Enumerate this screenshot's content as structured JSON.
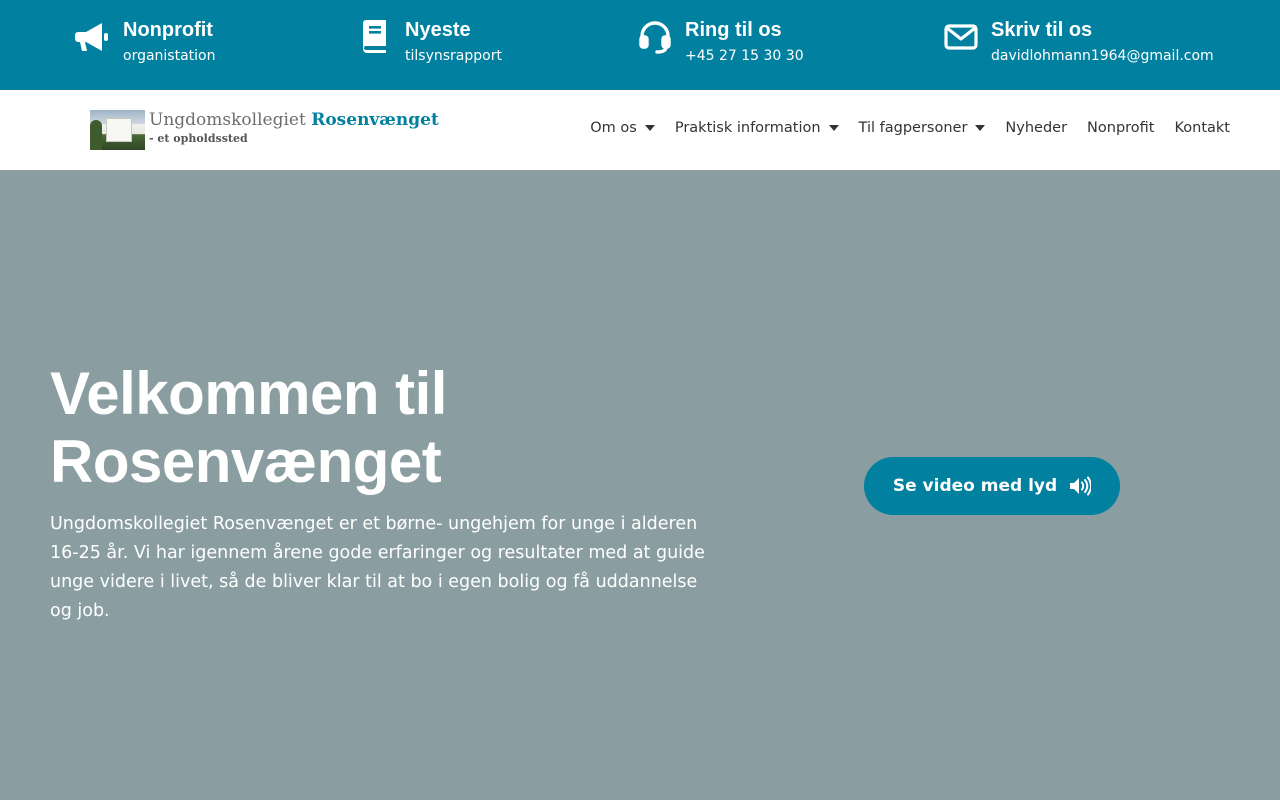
{
  "topbar": {
    "items": [
      {
        "icon": "megaphone-icon",
        "title": "Nonprofit",
        "subtitle": "organistation"
      },
      {
        "icon": "book-icon",
        "title": "Nyeste",
        "subtitle": "tilsynsrapport"
      },
      {
        "icon": "headset-icon",
        "title": "Ring til os",
        "subtitle": "+45 27 15 30 30"
      },
      {
        "icon": "envelope-icon",
        "title": "Skriv til os",
        "subtitle": "davidlohmann1964@gmail.com"
      }
    ],
    "background": "#01809f"
  },
  "header": {
    "logo": {
      "name_part1": "Ungdomskollegiet",
      "name_part2": "Rosenvænget",
      "tagline": "- et opholdssted"
    },
    "nav": [
      {
        "label": "Om os",
        "has_dropdown": true
      },
      {
        "label": "Praktisk information",
        "has_dropdown": true
      },
      {
        "label": "Til fagpersoner",
        "has_dropdown": true
      },
      {
        "label": "Nyheder",
        "has_dropdown": false
      },
      {
        "label": "Nonprofit",
        "has_dropdown": false
      },
      {
        "label": "Kontakt",
        "has_dropdown": false
      }
    ]
  },
  "hero": {
    "heading": "Velkommen til Rosenvænget",
    "body": "Ungdomskollegiet Rosenvænget er et børne- ungehjem for unge i alderen 16-25 år. Vi har igennem årene gode erfaringer og resultater med at guide unge videre i livet, så de bliver klar til at bo i egen bolig og få uddannelse og job.",
    "video_button": {
      "label": "Se video med lyd",
      "icon": "volume-icon"
    },
    "background": "#8a9da1"
  },
  "colors": {
    "accent": "#01809f",
    "text_dark": "#333333",
    "white": "#ffffff"
  }
}
